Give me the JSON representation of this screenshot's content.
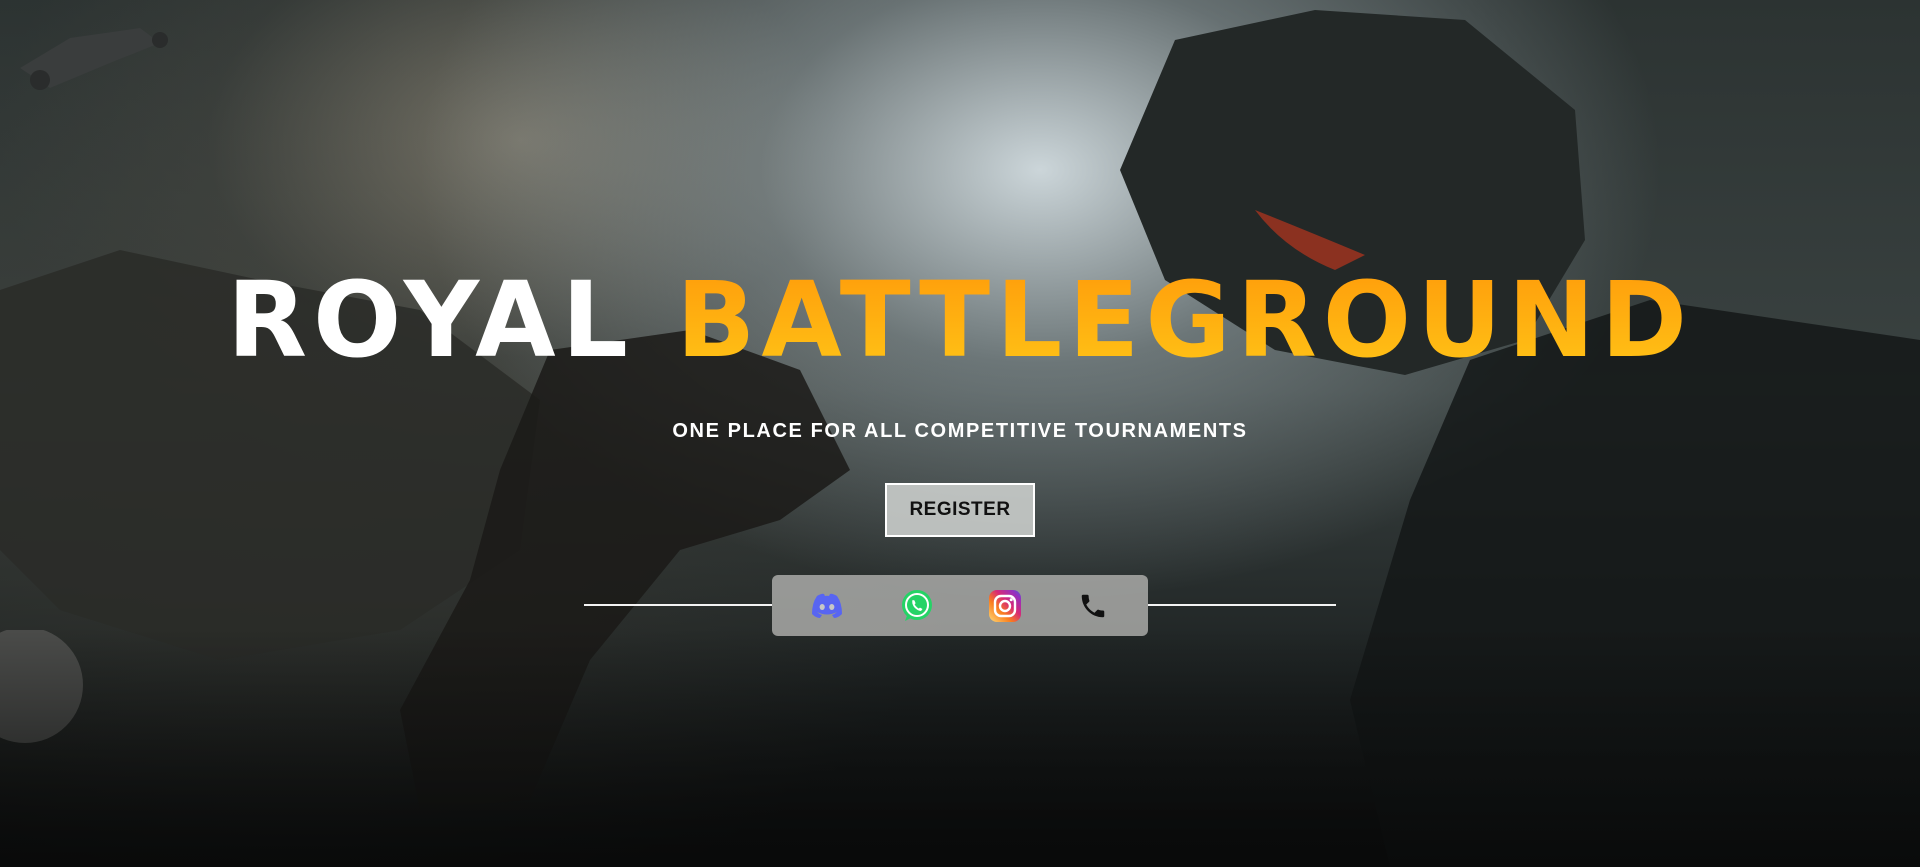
{
  "hero": {
    "title_part1": "ROYAL",
    "title_part2": "BATTLEGROUND",
    "tagline": "ONE PLACE FOR ALL COMPETITIVE TOURNAMENTS",
    "register_label": "REGISTER"
  },
  "social": {
    "icons": [
      "discord-icon",
      "whatsapp-icon",
      "instagram-icon",
      "phone-icon"
    ]
  },
  "colors": {
    "title_white": "#ffffff",
    "title_orange": "#ffa110",
    "discord": "#5865F2",
    "whatsapp": "#25D366",
    "instagram": "#E1306C"
  }
}
